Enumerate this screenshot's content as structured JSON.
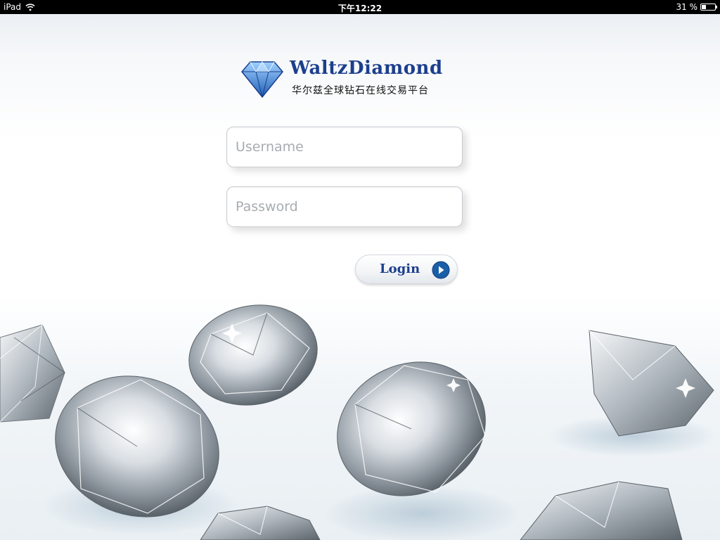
{
  "status_bar": {
    "device": "iPad",
    "time": "下午12:22",
    "battery": "31 %",
    "battery_level": 0.31
  },
  "brand": {
    "name": "WaltzDiamond",
    "tagline": "华尔兹全球钻石在线交易平台",
    "colors": {
      "primary": "#1c3f8d",
      "logo_blue": "#3f8fd8"
    }
  },
  "login_form": {
    "username_placeholder": "Username",
    "username_value": "",
    "password_placeholder": "Password",
    "password_value": "",
    "login_label": "Login"
  },
  "icons": {
    "wifi": "wifi-icon",
    "battery": "battery-icon",
    "logo": "diamond-logo-icon",
    "login_arrow": "arrow-right-circle-icon"
  }
}
